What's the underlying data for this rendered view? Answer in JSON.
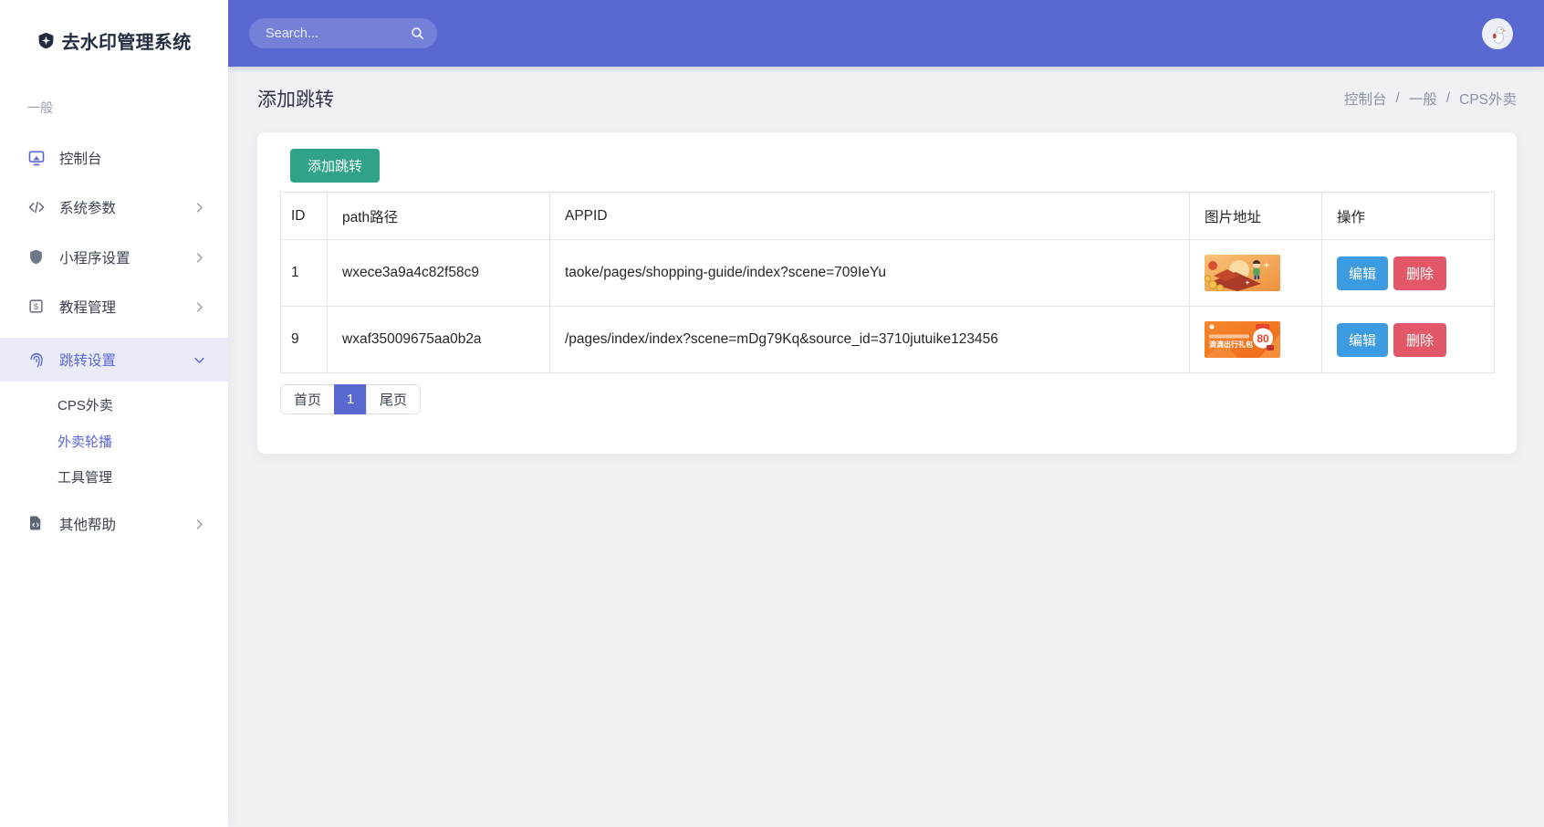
{
  "app": {
    "title": "去水印管理系统"
  },
  "topbar": {
    "search_placeholder": "Search..."
  },
  "sidebar": {
    "section": "一般",
    "items": [
      {
        "label": "控制台"
      },
      {
        "label": "系统参数"
      },
      {
        "label": "小程序设置"
      },
      {
        "label": "教程管理"
      },
      {
        "label": "跳转设置"
      },
      {
        "label": "其他帮助"
      }
    ],
    "submenu": [
      {
        "label": "CPS外卖"
      },
      {
        "label": "外卖轮播"
      },
      {
        "label": "工具管理"
      }
    ]
  },
  "page": {
    "title": "添加跳转",
    "breadcrumb": {
      "items": [
        "控制台",
        "一般",
        "CPS外卖"
      ],
      "separator": "/"
    }
  },
  "main": {
    "add_button": "添加跳转",
    "table": {
      "headers": [
        "ID",
        "path路径",
        "APPID",
        "图片地址",
        "操作"
      ],
      "rows": [
        {
          "id": "1",
          "path": "wxece3a9a4c82f58c9",
          "appid": "taoke/pages/shopping-guide/index?scene=709IeYu",
          "edit": "编辑",
          "delete": "删除"
        },
        {
          "id": "9",
          "path": "wxaf35009675aa0b2a",
          "appid": "/pages/index/index?scene=mDg79Kq&source_id=3710jutuike123456",
          "banner_text": "滴滴出行礼包",
          "banner_badge": "80",
          "edit": "编辑",
          "delete": "删除"
        }
      ]
    },
    "pagination": {
      "first": "首页",
      "current": "1",
      "last": "尾页"
    }
  },
  "colors": {
    "primary": "#5A68D2",
    "success": "#2FA287",
    "info": "#3D9BE2",
    "danger": "#E25868",
    "sidebar_active_bg": "#E9EBF9",
    "body_bg": "#EFF1F4"
  }
}
